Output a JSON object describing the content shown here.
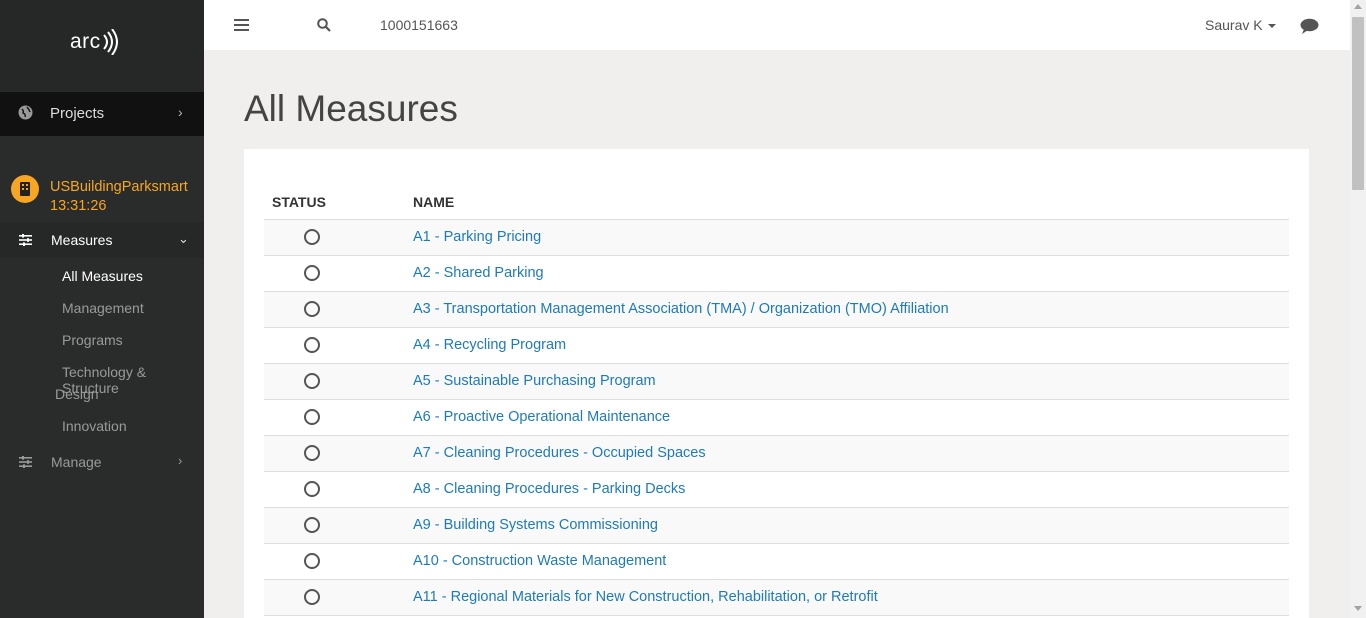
{
  "app": {
    "logo_text": "arc"
  },
  "sidebar": {
    "projects_label": "Projects",
    "project_name_line1": "USBuildingParksmart",
    "project_name_line2": "13:31:26",
    "measures_label": "Measures",
    "sub_items": [
      "All Measures",
      "Management",
      "Programs",
      "Technology & Structure",
      "Design",
      "Innovation"
    ],
    "manage_label": "Manage"
  },
  "topbar": {
    "project_id": "1000151663",
    "user_name": "Saurav K"
  },
  "main": {
    "title": "All Measures",
    "columns": [
      "STATUS",
      "NAME"
    ],
    "rows": [
      "A1 - Parking Pricing",
      "A2 - Shared Parking",
      "A3 - Transportation Management Association (TMA) / Organization (TMO) Affiliation",
      "A4 - Recycling Program",
      "A5 - Sustainable Purchasing Program",
      "A6 - Proactive Operational Maintenance",
      "A7 - Cleaning Procedures - Occupied Spaces",
      "A8 - Cleaning Procedures - Parking Decks",
      "A9 - Building Systems Commissioning",
      "A10 - Construction Waste Management",
      "A11 - Regional Materials for New Construction, Rehabilitation, or Retrofit"
    ]
  },
  "colors": {
    "accent": "#f6a623",
    "link": "#1f7ab8",
    "sidebar_bg": "#2a2b2b"
  }
}
